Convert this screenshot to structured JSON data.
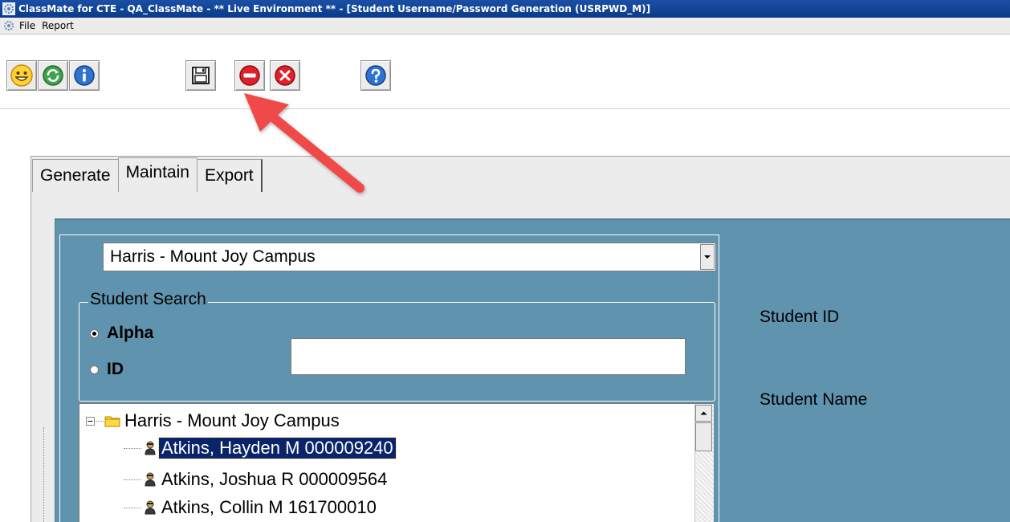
{
  "window": {
    "title": "ClassMate for CTE - QA_ClassMate - ** Live Environment ** - [Student Username/Password Generation (USRPWD_M)]"
  },
  "menu": {
    "items": [
      "File",
      "Report"
    ]
  },
  "toolbar": {
    "buttons": [
      {
        "name": "smiley-icon"
      },
      {
        "name": "refresh-icon"
      },
      {
        "name": "info-icon"
      },
      {
        "name": "save-icon"
      },
      {
        "name": "stop-icon"
      },
      {
        "name": "close-icon"
      },
      {
        "name": "help-icon"
      }
    ]
  },
  "tabs": [
    {
      "label": "Generate",
      "active": false
    },
    {
      "label": "Maintain",
      "active": true
    },
    {
      "label": "Export",
      "active": false
    }
  ],
  "campus_dropdown": {
    "selected": "Harris - Mount Joy Campus"
  },
  "student_search": {
    "legend": "Student Search",
    "options": [
      {
        "label": "Alpha",
        "checked": true
      },
      {
        "label": "ID",
        "checked": false
      }
    ],
    "input_value": ""
  },
  "tree": {
    "root": "Harris - Mount Joy Campus",
    "students": [
      {
        "label": "Atkins,  Hayden M 000009240",
        "selected": true
      },
      {
        "label": "Atkins,  Joshua R 000009564",
        "selected": false
      },
      {
        "label": "Atkins,  Collin M 161700010",
        "selected": false
      }
    ]
  },
  "details": {
    "student_id_label": "Student ID",
    "student_name_label": "Student Name"
  },
  "colors": {
    "panel_blue": "#6093ad",
    "selection": "#0a246a",
    "arrow": "#f04848"
  }
}
